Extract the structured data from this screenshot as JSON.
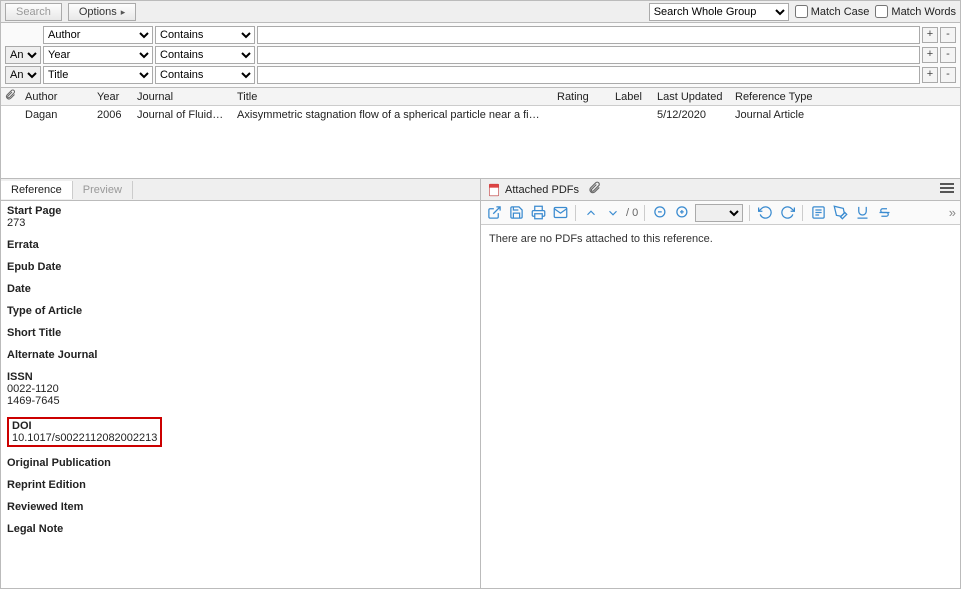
{
  "toolbar": {
    "search_label": "Search",
    "options_label": "Options",
    "scope_selected": "Search Whole Group",
    "match_case_label": "Match Case",
    "match_words_label": "Match Words"
  },
  "search_rows": [
    {
      "op": "",
      "field": "Author",
      "cond": "Contains",
      "value": ""
    },
    {
      "op": "And",
      "field": "Year",
      "cond": "Contains",
      "value": ""
    },
    {
      "op": "And",
      "field": "Title",
      "cond": "Contains",
      "value": ""
    }
  ],
  "results": {
    "headers": {
      "author": "Author",
      "year": "Year",
      "journal": "Journal",
      "title": "Title",
      "rating": "Rating",
      "label": "Label",
      "updated": "Last Updated",
      "reftype": "Reference Type"
    },
    "rows": [
      {
        "author": "Dagan",
        "year": "2006",
        "journal": "Journal of Fluid Mechan...",
        "title": "Axisymmetric stagnation flow of a spherical particle near a finite planar surface ...",
        "rating": "",
        "label": "",
        "updated": "5/12/2020",
        "reftype": "Journal Article"
      }
    ]
  },
  "tabs": {
    "reference": "Reference",
    "preview": "Preview"
  },
  "ref_fields": [
    {
      "label": "Start Page",
      "value": "273"
    },
    {
      "label": "Errata",
      "value": ""
    },
    {
      "label": "Epub Date",
      "value": ""
    },
    {
      "label": "Date",
      "value": ""
    },
    {
      "label": "Type of Article",
      "value": ""
    },
    {
      "label": "Short Title",
      "value": ""
    },
    {
      "label": "Alternate Journal",
      "value": ""
    },
    {
      "label": "ISSN",
      "value": "0022-1120\n1469-7645"
    },
    {
      "label": "DOI",
      "value": "10.1017/s0022112082002213",
      "highlight": true
    },
    {
      "label": "Original Publication",
      "value": ""
    },
    {
      "label": "Reprint Edition",
      "value": ""
    },
    {
      "label": "Reviewed Item",
      "value": ""
    },
    {
      "label": "Legal Note",
      "value": ""
    }
  ],
  "right": {
    "title": "Attached PDFs",
    "page_indicator": "/ 0",
    "body_text": "There are no PDFs attached to this reference."
  }
}
